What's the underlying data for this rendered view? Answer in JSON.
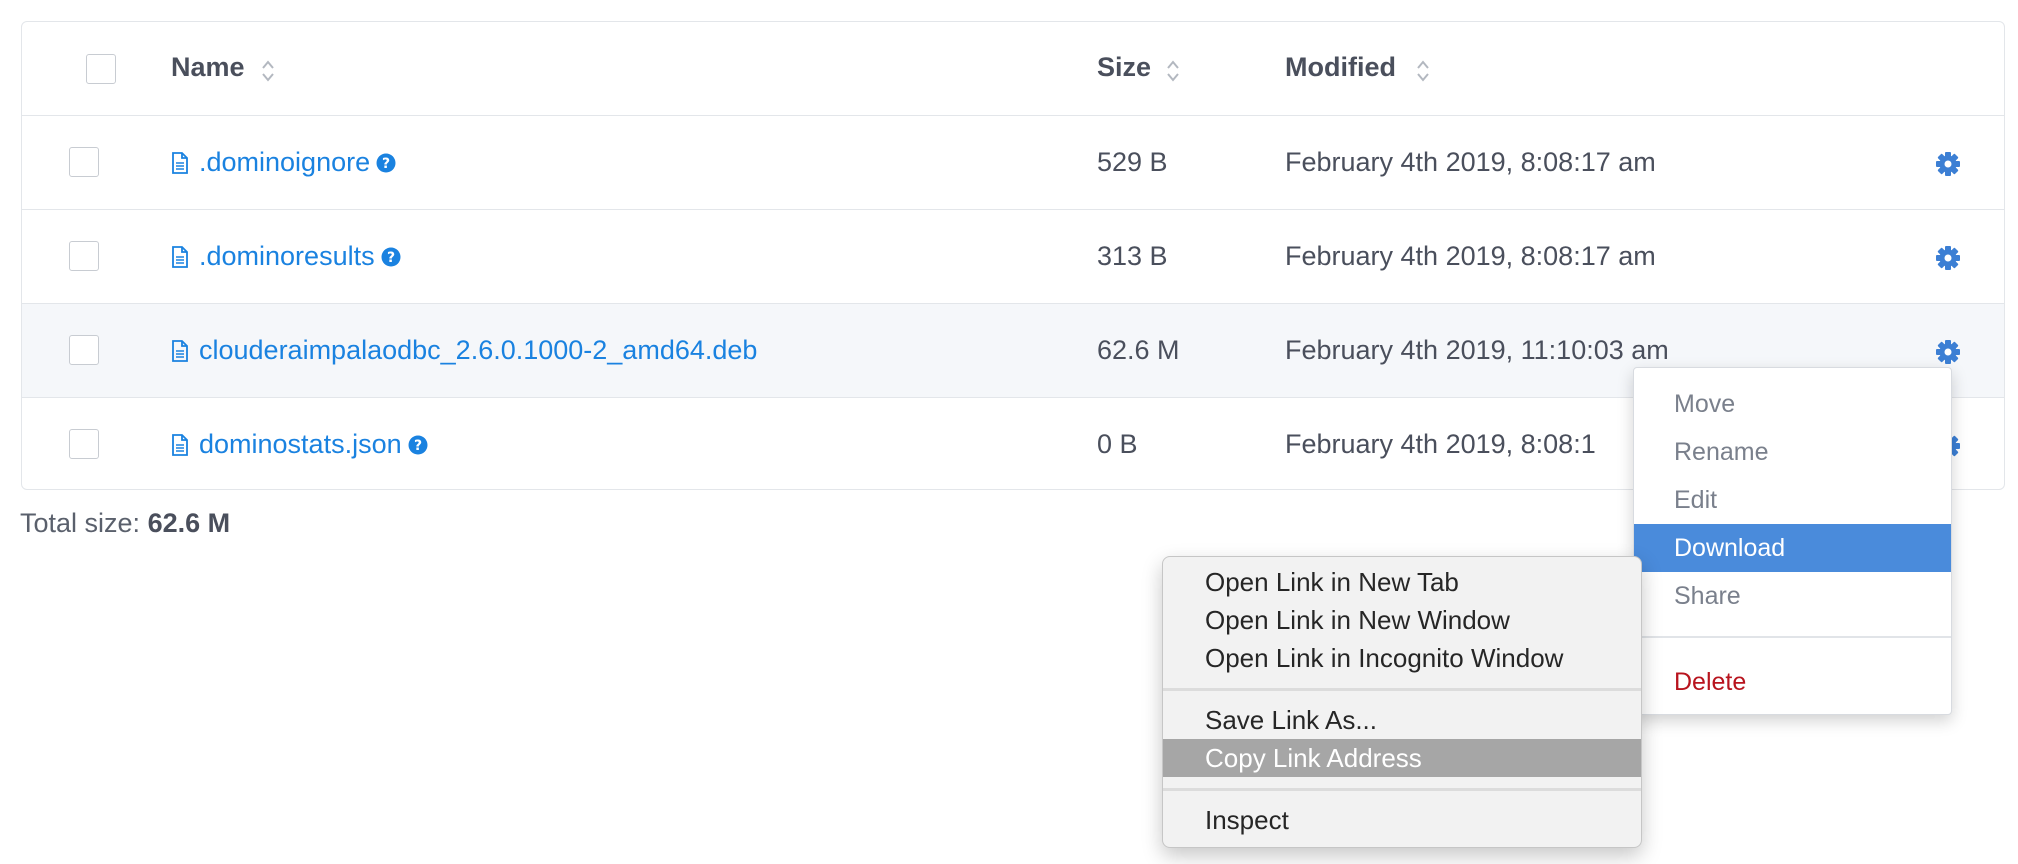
{
  "table": {
    "headers": {
      "name": "Name",
      "size": "Size",
      "modified": "Modified"
    },
    "rows": [
      {
        "name": ".dominoignore",
        "size": "529 B",
        "modified": "February 4th 2019, 8:08:17 am",
        "has_help": true
      },
      {
        "name": ".dominoresults",
        "size": "313 B",
        "modified": "February 4th 2019, 8:08:17 am",
        "has_help": true
      },
      {
        "name": "clouderaimpalaodbc_2.6.0.1000-2_amd64.deb",
        "size": "62.6 M",
        "modified": "February 4th 2019, 11:10:03 am",
        "has_help": false
      },
      {
        "name": "dominostats.json",
        "size": "0 B",
        "modified": "February 4th 2019, 8:08:1",
        "has_help": true
      }
    ]
  },
  "footer": {
    "total_label": "Total size:",
    "total_value": "62.6 M"
  },
  "file_actions_menu": {
    "items": [
      "Move",
      "Rename",
      "Edit",
      "Download",
      "Share"
    ],
    "active": "Download",
    "danger_item": "Delete"
  },
  "context_menu": {
    "group1": [
      "Open Link in New Tab",
      "Open Link in New Window",
      "Open Link in Incognito Window"
    ],
    "group2": [
      "Save Link As...",
      "Copy Link Address"
    ],
    "group3": [
      "Inspect"
    ],
    "highlighted": "Copy Link Address"
  },
  "colors": {
    "link": "#1a82e0",
    "active": "#4a8bdb",
    "danger": "#b8141e",
    "gear": "#3c7fd4"
  },
  "icons": {
    "sort": "sort-arrows-icon",
    "file": "file-icon",
    "help": "help-circle-icon",
    "gear": "gear-icon"
  }
}
